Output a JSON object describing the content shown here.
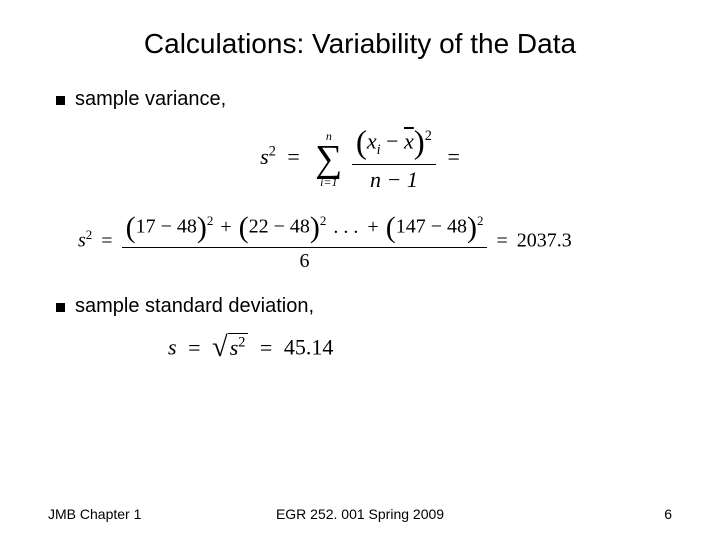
{
  "title": "Calculations: Variability of the Data",
  "bullets": {
    "variance": "sample variance,",
    "stddev": "sample standard deviation,"
  },
  "formulas": {
    "variance_def": {
      "lhs": "s",
      "lhs_exp": "2",
      "eq": "=",
      "sum_top": "n",
      "sum_bot": "i=1",
      "num_open": "(",
      "num_xi": "x",
      "num_xi_sub": "i",
      "num_minus": " − ",
      "num_xbar": "x",
      "num_close": ")",
      "num_exp": "2",
      "den": "n − 1",
      "trail_eq": "="
    },
    "variance_calc": {
      "lhs": "s",
      "lhs_exp": "2",
      "eq": "=",
      "t1_a": "17",
      "t1_b": "48",
      "t2_a": "22",
      "t2_b": "48",
      "dots": ". . .",
      "t3_a": "147",
      "t3_b": "48",
      "exp": "2",
      "plus": "+",
      "den": "6",
      "eq2": "=",
      "result": "2037.3"
    },
    "stddev_calc": {
      "lhs": "s",
      "eq": "=",
      "rad_arg": "s",
      "rad_exp": "2",
      "eq2": "=",
      "result": "45.14"
    }
  },
  "footer": {
    "left": "JMB   Chapter 1",
    "center": "EGR 252. 001 Spring 2009",
    "right": "6"
  }
}
